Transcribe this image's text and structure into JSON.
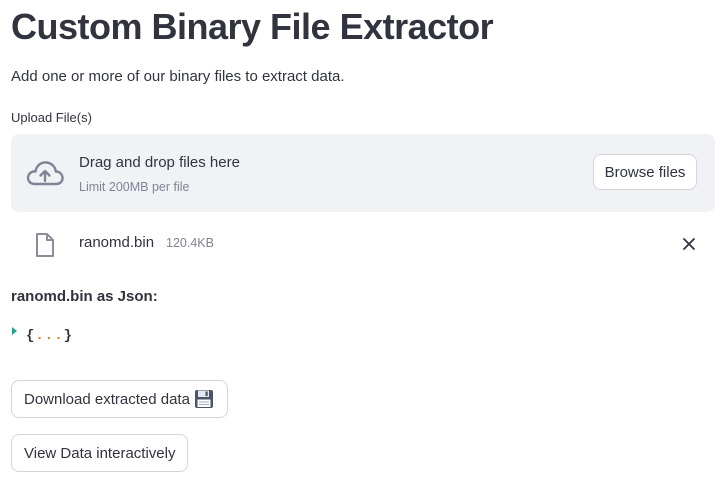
{
  "header": {
    "title": "Custom Binary File Extractor",
    "subtitle": "Add one or more of our binary files to extract data."
  },
  "uploader": {
    "label": "Upload File(s)",
    "dropzone_text": "Drag and drop files here",
    "limit_text": "Limit 200MB per file",
    "browse_label": "Browse files",
    "cloud_icon": "cloud-upload-icon"
  },
  "uploaded_file": {
    "name": "ranomd.bin",
    "size": "120.4KB",
    "file_icon": "file-icon",
    "remove_icon": "close-icon"
  },
  "json_view": {
    "heading": "ranomd.bin as Json:",
    "open_brace": "{",
    "dots": "...",
    "close_brace": "}"
  },
  "actions": {
    "download_label": "Download extracted data",
    "download_icon": "floppy-disk-icon",
    "view_label": "View Data interactively"
  },
  "colors": {
    "text": "#31333f",
    "muted": "#808495",
    "dropzone_bg": "#f0f2f6",
    "border": "#d3d5da",
    "toggle": "#2a9d8f",
    "dots": "#d9822b"
  }
}
